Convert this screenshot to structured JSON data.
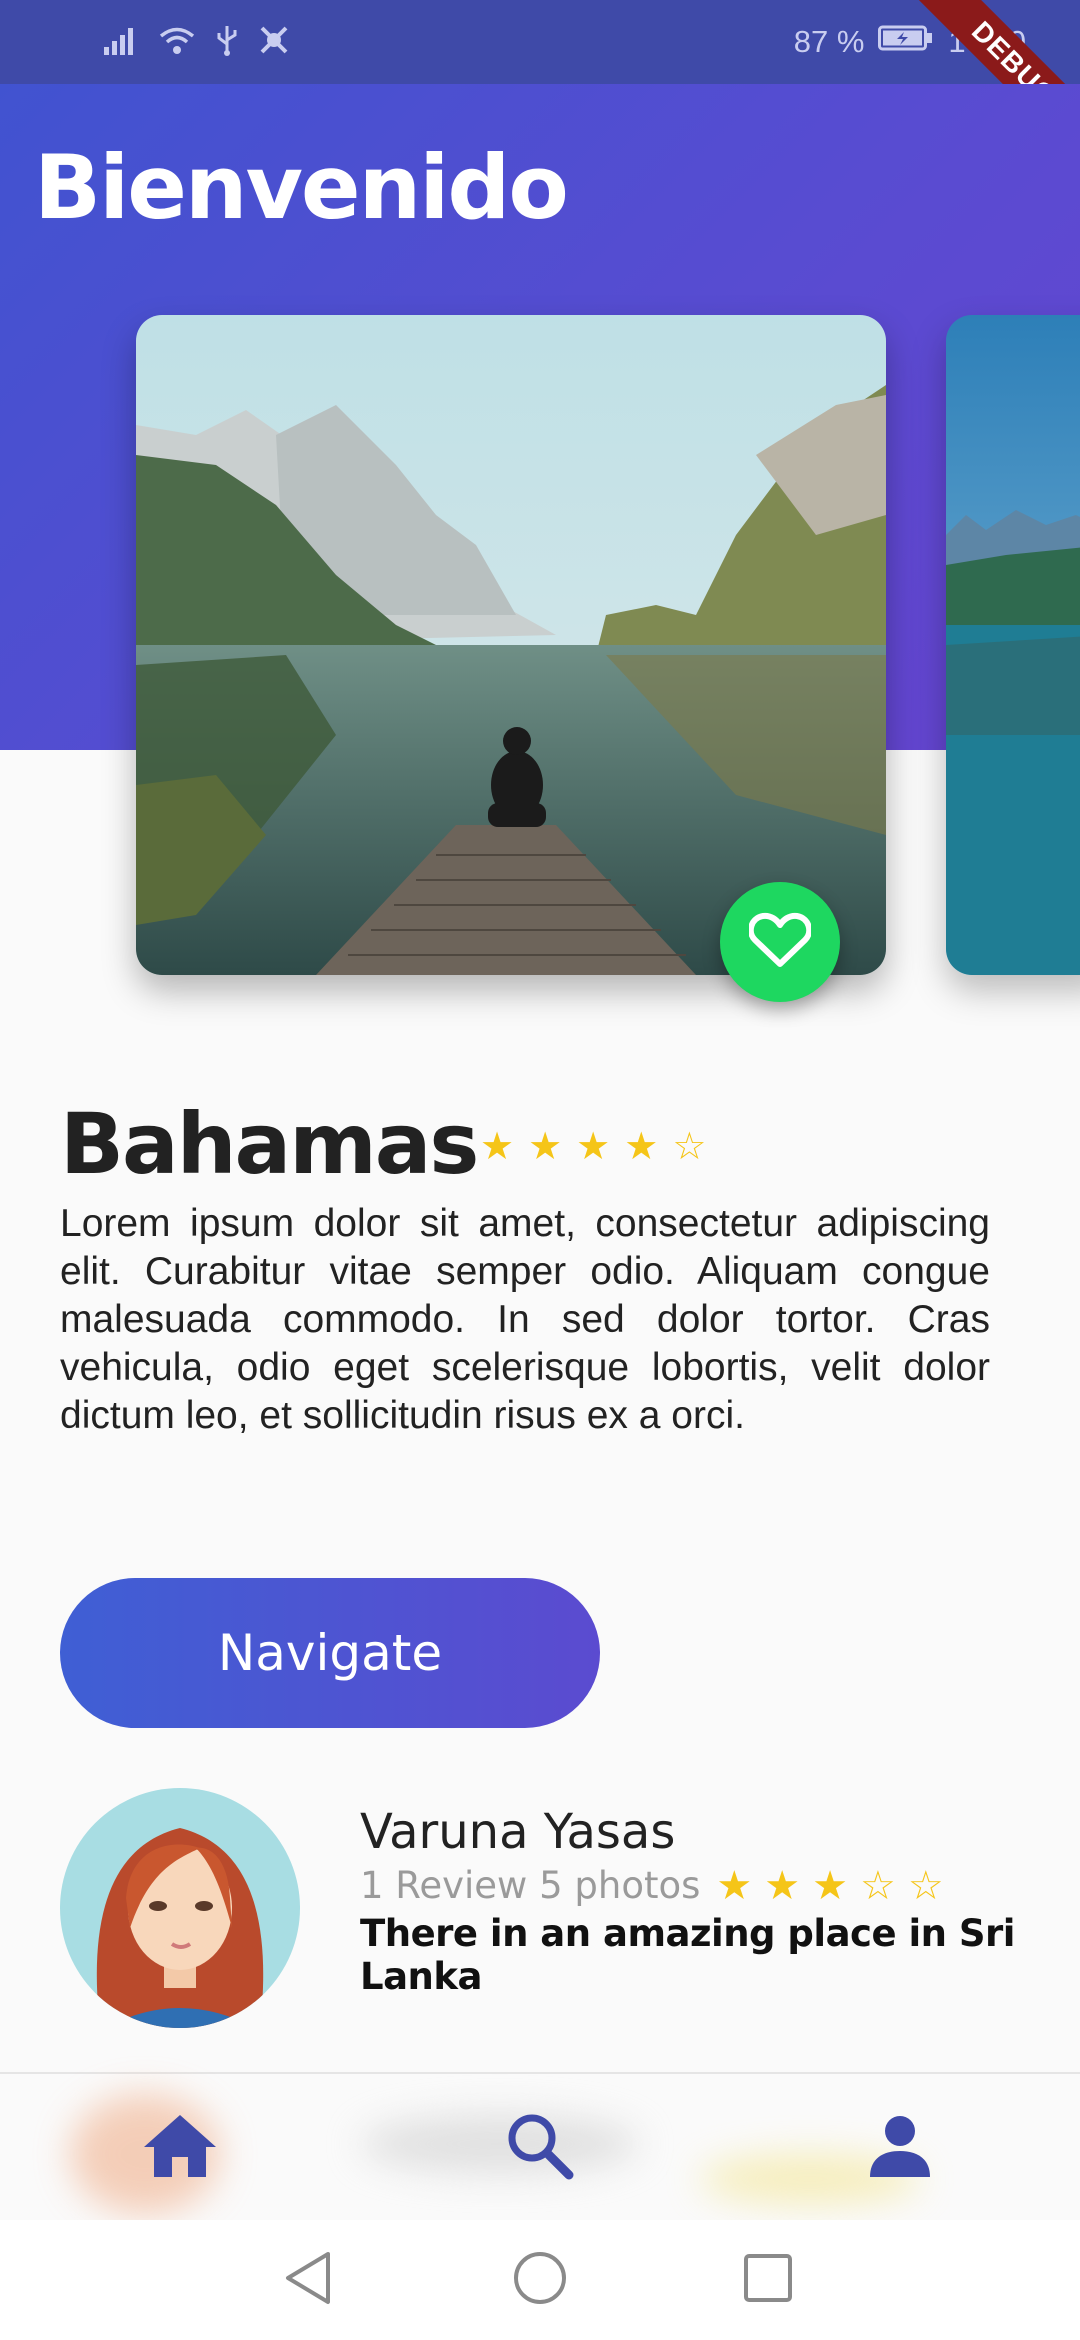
{
  "status_bar": {
    "battery_percent": "87 %",
    "time": "17:00",
    "debug_label": "DEBUG"
  },
  "header": {
    "title": "Bienvenido"
  },
  "place": {
    "name": "Bahamas",
    "rating": 4,
    "rating_max": 5,
    "description": "Lorem ipsum dolor sit amet, consectetur adipiscing elit. Curabitur vitae semper odio. Aliquam congue malesuada commodo. In sed dolor tortor. Cras vehicula, odio eget scelerisque lobortis, velit dolor dictum leo, et sollicitudin risus ex a orci."
  },
  "actions": {
    "navigate_label": "Navigate"
  },
  "review": {
    "author": "Varuna Yasas",
    "meta": "1 Review 5 photos",
    "rating": 3,
    "rating_max": 5,
    "comment": "There in an amazing place in Sri Lanka"
  },
  "bottom_nav": {
    "items": [
      {
        "icon": "home-icon",
        "active": true
      },
      {
        "icon": "search-icon",
        "active": false
      },
      {
        "icon": "person-icon",
        "active": false
      }
    ]
  },
  "colors": {
    "primary": "#4a50d0",
    "accent_green": "#1ed760",
    "star": "#f5c518"
  }
}
